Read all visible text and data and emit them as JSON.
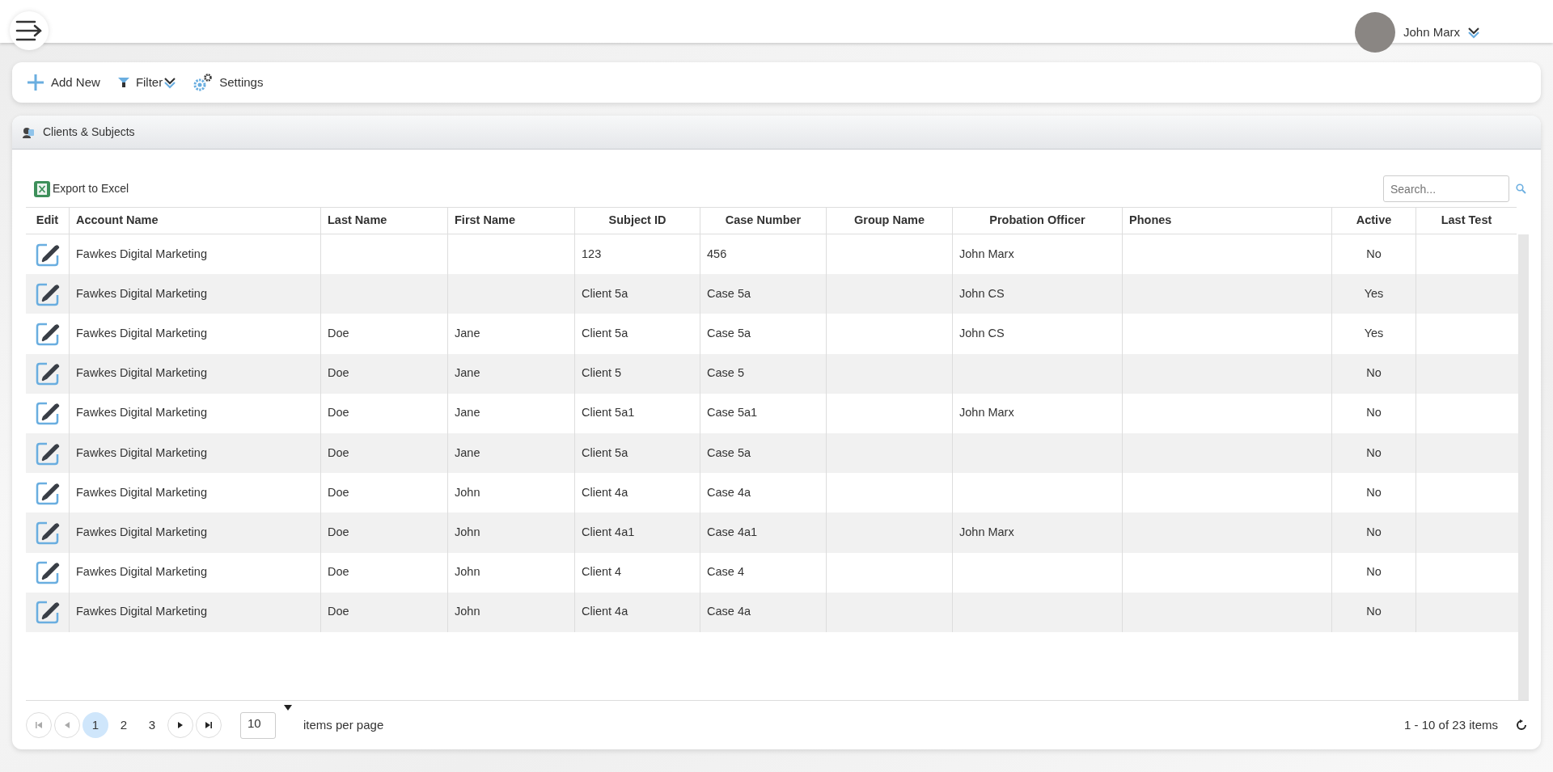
{
  "header": {
    "user_name": "John Marx"
  },
  "toolbar": [
    {
      "kind": "add",
      "label": "Add New"
    },
    {
      "kind": "filter",
      "label": "Filter"
    },
    {
      "kind": "settings",
      "label": "Settings"
    }
  ],
  "panel": {
    "title": "Clients & Subjects",
    "export_label": "Export to Excel",
    "search": {
      "placeholder": "Search..."
    }
  },
  "table": {
    "columns": [
      "Edit",
      "Account Name",
      "Last Name",
      "First Name",
      "Subject ID",
      "Case Number",
      "Group Name",
      "Probation Officer",
      "Phones",
      "Active",
      "Last Test"
    ],
    "rows": [
      {
        "account_name": "Fawkes Digital Marketing",
        "subject_id": "123",
        "case_number": "456",
        "probation_officer": "John Marx",
        "active": "No"
      },
      {
        "account_name": "Fawkes Digital Marketing",
        "subject_id": "Client 5a",
        "case_number": "Case 5a",
        "probation_officer": "John CS",
        "active": "Yes"
      },
      {
        "account_name": "Fawkes Digital Marketing",
        "last_name": "Doe",
        "first_name": "Jane",
        "subject_id": "Client 5a",
        "case_number": "Case 5a",
        "probation_officer": "John CS",
        "active": "Yes"
      },
      {
        "account_name": "Fawkes Digital Marketing",
        "last_name": "Doe",
        "first_name": "Jane",
        "subject_id": "Client 5",
        "case_number": "Case 5",
        "active": "No"
      },
      {
        "account_name": "Fawkes Digital Marketing",
        "last_name": "Doe",
        "first_name": "Jane",
        "subject_id": "Client 5a1",
        "case_number": "Case 5a1",
        "probation_officer": "John Marx",
        "active": "No"
      },
      {
        "account_name": "Fawkes Digital Marketing",
        "last_name": "Doe",
        "first_name": "Jane",
        "subject_id": "Client 5a",
        "case_number": "Case 5a",
        "active": "No"
      },
      {
        "account_name": "Fawkes Digital Marketing",
        "last_name": "Doe",
        "first_name": "John",
        "subject_id": "Client 4a",
        "case_number": "Case 4a",
        "active": "No"
      },
      {
        "account_name": "Fawkes Digital Marketing",
        "last_name": "Doe",
        "first_name": "John",
        "subject_id": "Client 4a1",
        "case_number": "Case 4a1",
        "probation_officer": "John Marx",
        "active": "No"
      },
      {
        "account_name": "Fawkes Digital Marketing",
        "last_name": "Doe",
        "first_name": "John",
        "subject_id": "Client 4",
        "case_number": "Case 4",
        "active": "No"
      },
      {
        "account_name": "Fawkes Digital Marketing",
        "last_name": "Doe",
        "first_name": "John",
        "subject_id": "Client 4a",
        "case_number": "Case 4a",
        "active": "No"
      }
    ]
  },
  "pager": {
    "pages": [
      {
        "label": "1",
        "selected": true
      },
      {
        "label": "2",
        "selected": false
      },
      {
        "label": "3",
        "selected": false
      }
    ],
    "page_size": "10",
    "page_size_label": "items per page",
    "summary": "1 - 10 of 23 items"
  }
}
